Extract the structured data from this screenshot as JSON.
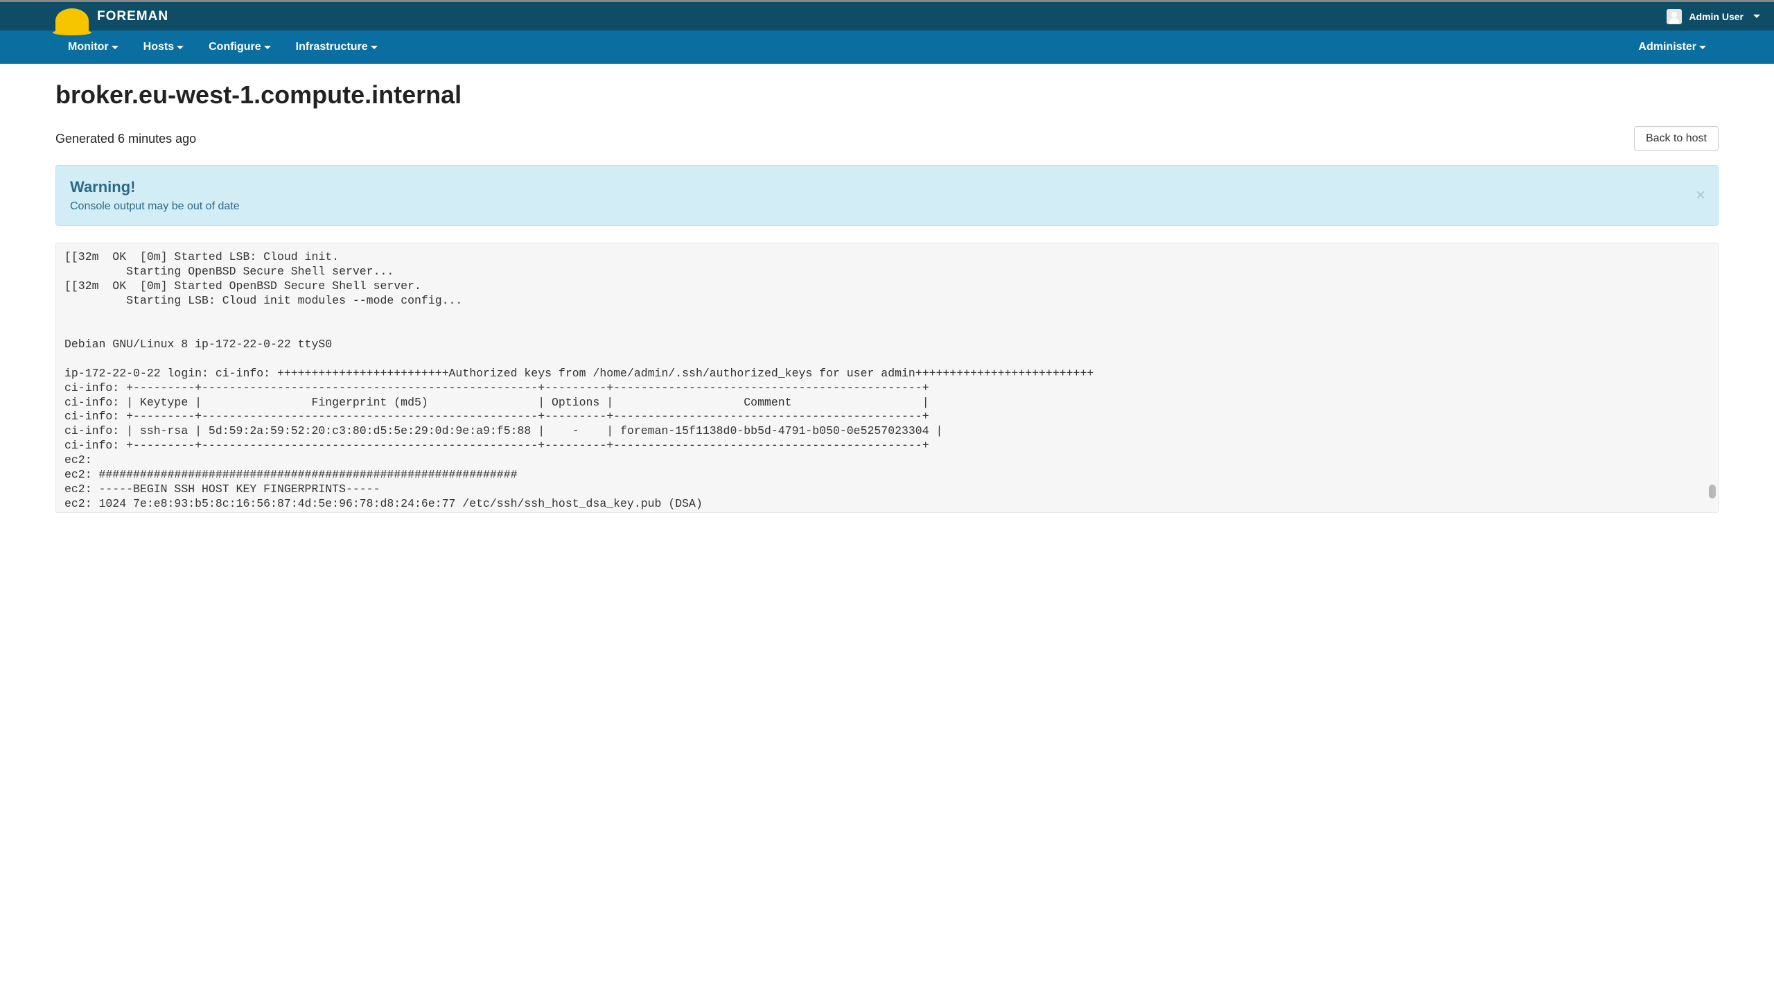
{
  "brand": "FOREMAN",
  "user": {
    "name": "Admin User"
  },
  "nav": {
    "items": [
      {
        "label": "Monitor"
      },
      {
        "label": "Hosts"
      },
      {
        "label": "Configure"
      },
      {
        "label": "Infrastructure"
      }
    ],
    "right": {
      "label": "Administer"
    }
  },
  "page": {
    "title": "broker.eu-west-1.compute.internal",
    "generated": "Generated 6 minutes ago",
    "back_button": "Back to host"
  },
  "alert": {
    "title": "Warning!",
    "body": "Console output may be out of date"
  },
  "console_output": "[[32m  OK  [0m] Started LSB: Cloud init.\n         Starting OpenBSD Secure Shell server...\n[[32m  OK  [0m] Started OpenBSD Secure Shell server.\n         Starting LSB: Cloud init modules --mode config...\n\n\nDebian GNU/Linux 8 ip-172-22-0-22 ttyS0\n\nip-172-22-0-22 login: ci-info: +++++++++++++++++++++++++Authorized keys from /home/admin/.ssh/authorized_keys for user admin++++++++++++++++++++++++++\nci-info: +---------+-------------------------------------------------+---------+---------------------------------------------+\nci-info: | Keytype |                Fingerprint (md5)                | Options |                   Comment                   |\nci-info: +---------+-------------------------------------------------+---------+---------------------------------------------+\nci-info: | ssh-rsa | 5d:59:2a:59:52:20:c3:80:d5:5e:29:0d:9e:a9:f5:88 |    -    | foreman-15f1138d0-bb5d-4791-b050-0e5257023304 |\nci-info: +---------+-------------------------------------------------+---------+---------------------------------------------+\nec2: \nec2: #############################################################\nec2: -----BEGIN SSH HOST KEY FINGERPRINTS-----\nec2: 1024 7e:e8:93:b5:8c:16:56:87:4d:5e:96:78:d8:24:6e:77 /etc/ssh/ssh_host_dsa_key.pub (DSA)"
}
